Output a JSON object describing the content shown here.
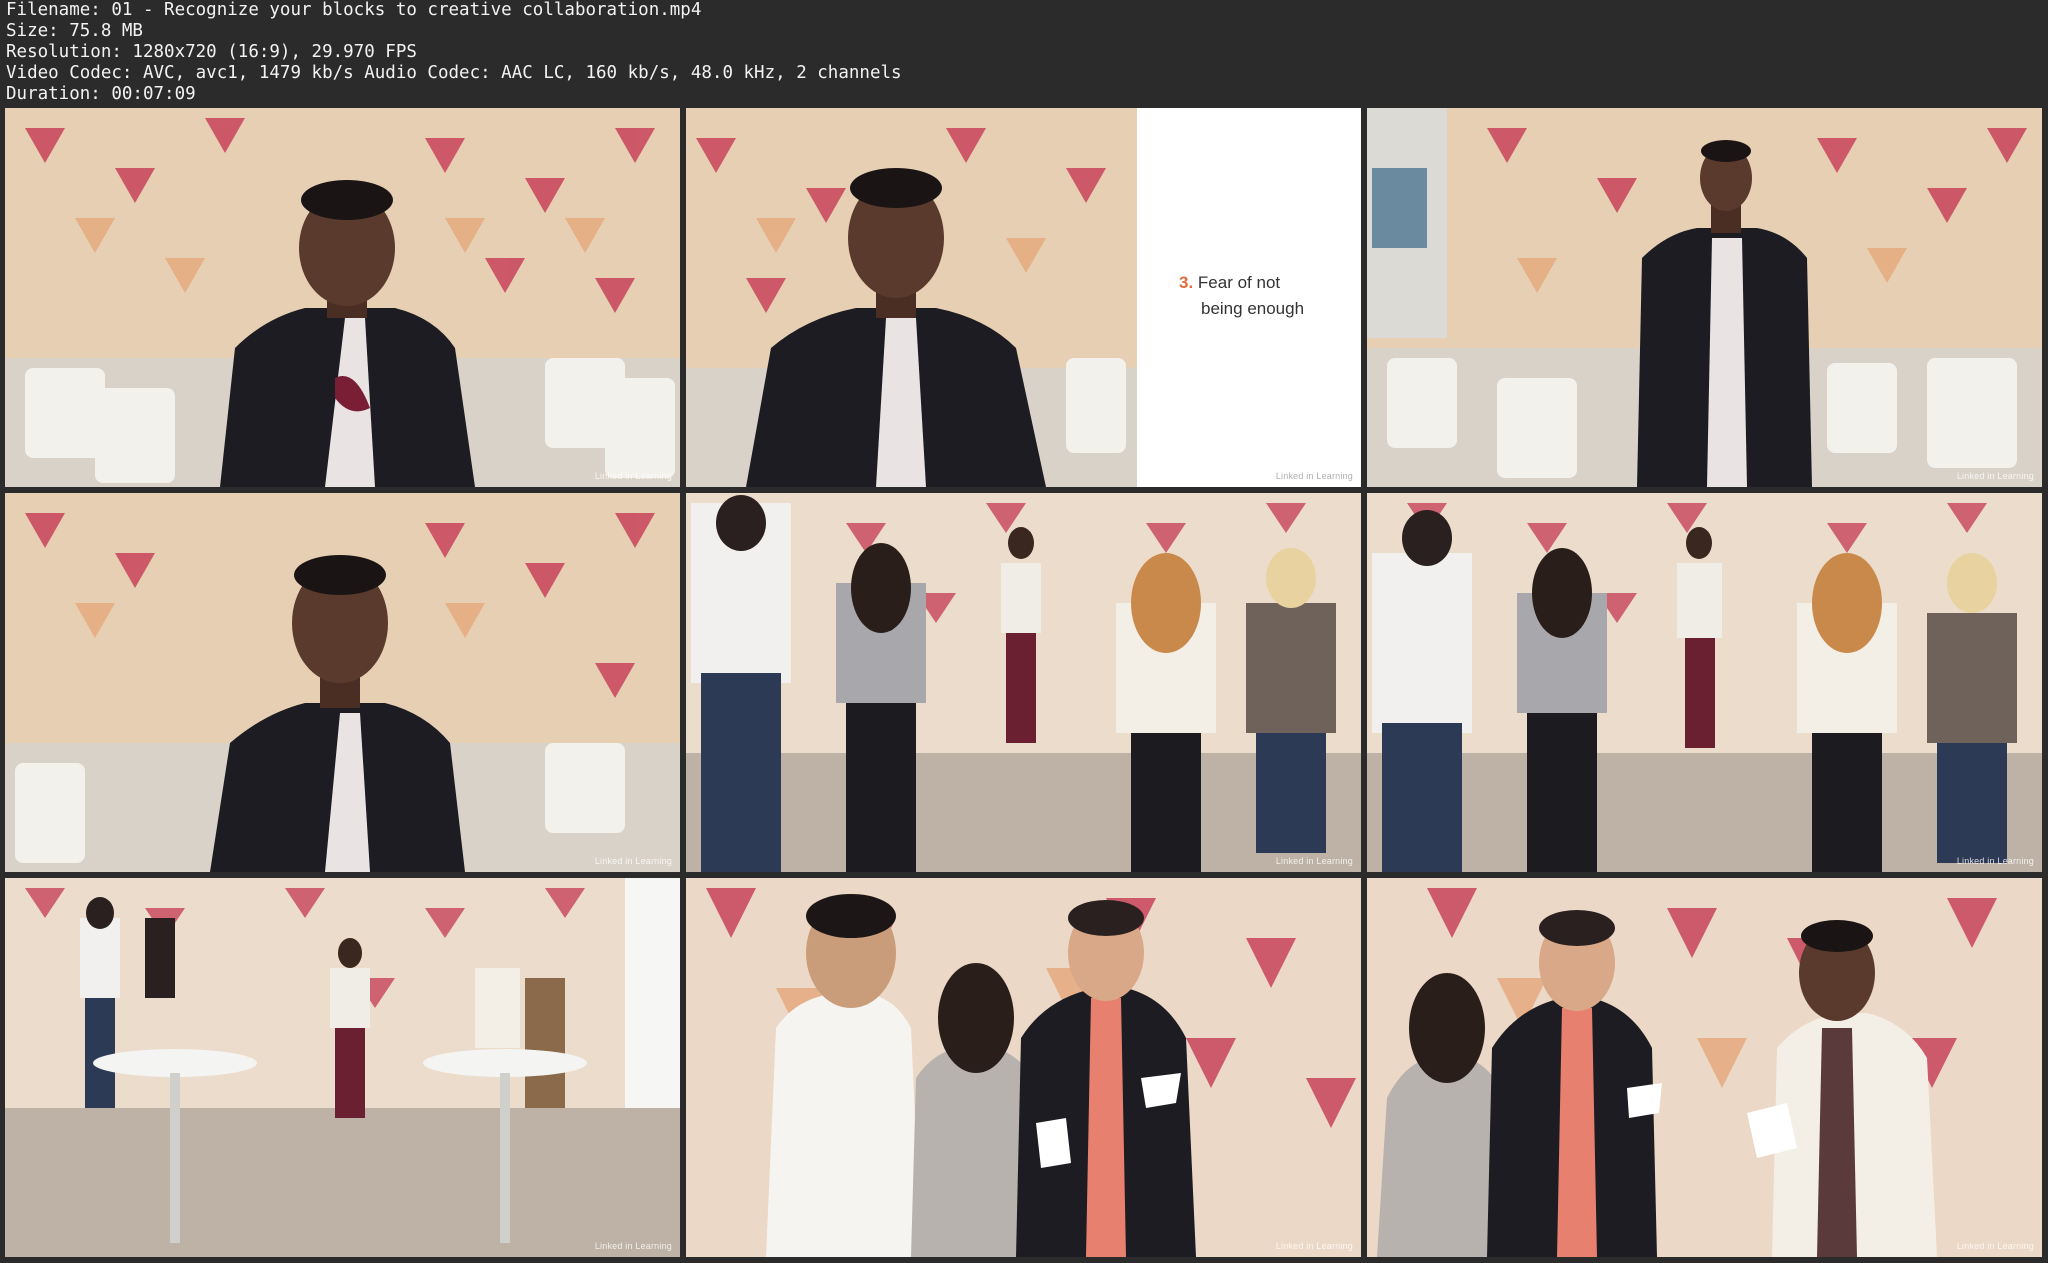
{
  "metadata": {
    "filename": "Filename: 01 - Recognize your blocks to creative collaboration.mp4",
    "size": "Size: 75.8 MB",
    "resolution": "Resolution: 1280x720 (16:9), 29.970 FPS",
    "codec": "Video Codec: AVC, avc1, 1479 kb/s Audio Codec: AAC LC, 160 kb/s, 48.0 kHz, 2 channels",
    "duration": "Duration: 00:07:09"
  },
  "slide": {
    "number": "3.",
    "line1": "Fear of not",
    "line2": "being enough"
  },
  "watermark": "Linked in Learning",
  "colors": {
    "background": "#2b2b2b",
    "wall": "#e8d2b8",
    "accent_red": "#b8344a",
    "slide_number": "#e26b3a"
  }
}
